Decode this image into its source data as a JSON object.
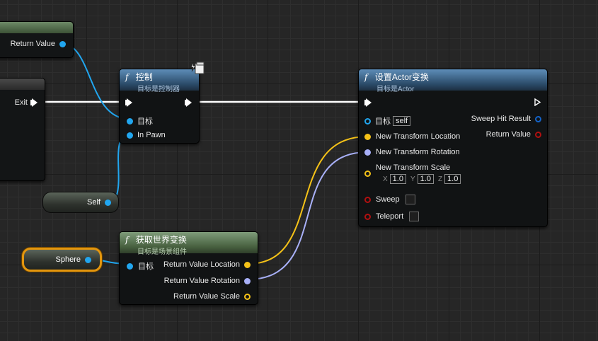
{
  "nodes": {
    "top_left": {
      "pin": "Return Value"
    },
    "mid_left": {
      "pin": "Exit"
    },
    "controller": {
      "f": "f",
      "title": "控制",
      "subtitle": "目标是控制器",
      "pins": {
        "target": "目标",
        "in_pawn": "In Pawn"
      },
      "icon": "network-replicated-icon"
    },
    "set_transform": {
      "f": "f",
      "title": "设置Actor变换",
      "subtitle": "目标是Actor",
      "pins": {
        "target": "目标",
        "target_default": "self",
        "location": "New Transform Location",
        "rotation": "New Transform Rotation",
        "scale": "New Transform Scale",
        "scale_x_label": "X",
        "scale_x": "1.0",
        "scale_y_label": "Y",
        "scale_y": "1.0",
        "scale_z_label": "Z",
        "scale_z": "1.0",
        "sweep": "Sweep",
        "teleport": "Teleport",
        "sweep_hit": "Sweep Hit Result",
        "return_value": "Return Value"
      }
    },
    "get_world_transform": {
      "f": "f",
      "title": "获取世界变换",
      "subtitle": "目标是场景组件",
      "pins": {
        "target": "目标",
        "location": "Return Value Location",
        "rotation": "Return Value Rotation",
        "scale": "Return Value Scale"
      }
    }
  },
  "variables": {
    "self": "Self",
    "sphere": "Sphere"
  },
  "colors": {
    "exec": "#ffffff",
    "object": "#21a6ef",
    "vector": "#f5c218",
    "rotator": "#a8b0f8",
    "struct_hit": "#1463c8",
    "bool": "#b01010",
    "selection": "#e3960e"
  }
}
